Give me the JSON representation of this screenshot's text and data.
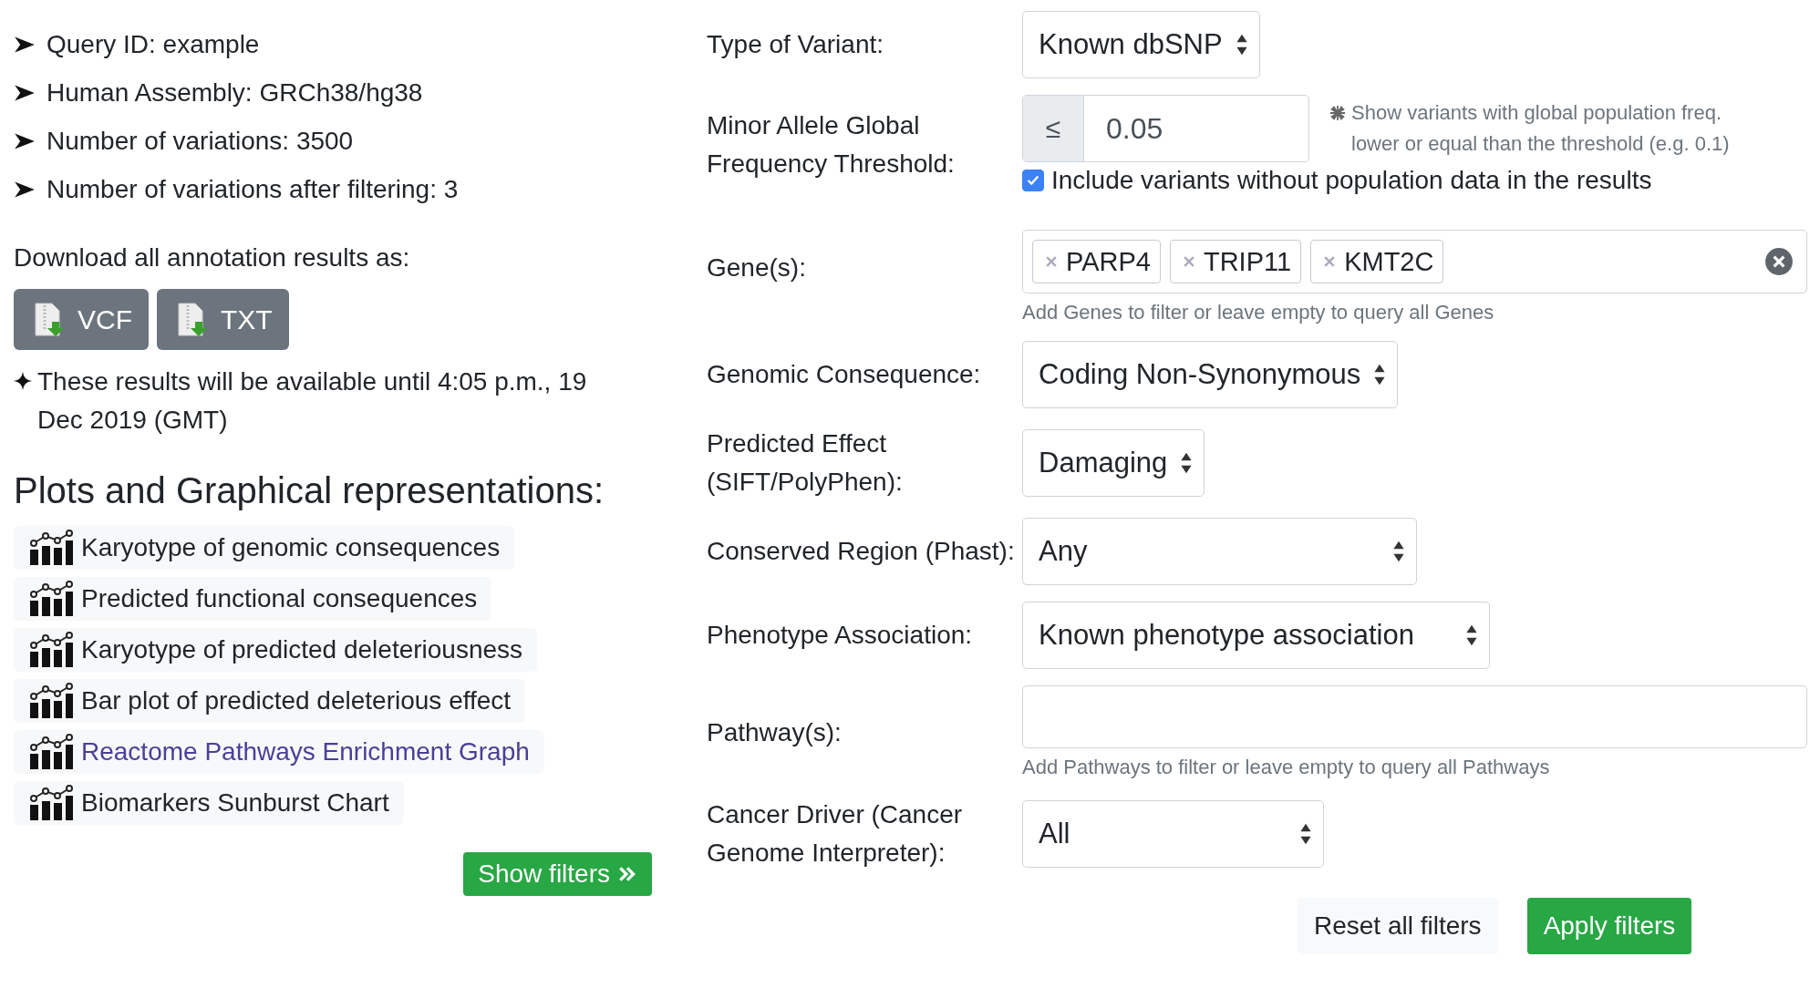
{
  "summary": [
    "Query ID: example",
    "Human Assembly: GRCh38/hg38",
    "Number of variations: 3500",
    "Number of variations after filtering: 3"
  ],
  "download": {
    "label": "Download all annotation results as:",
    "buttons": [
      "VCF",
      "TXT"
    ]
  },
  "availability": "These results will be available until 4:05 p.m., 19 Dec 2019 (GMT)",
  "plots": {
    "title": "Plots and Graphical representations:",
    "items": [
      {
        "label": "Karyotype of genomic consequences",
        "kind": "text"
      },
      {
        "label": "Predicted functional consequences",
        "kind": "text"
      },
      {
        "label": "Karyotype of predicted deleteriousness",
        "kind": "text"
      },
      {
        "label": "Bar plot of predicted deleterious effect",
        "kind": "text"
      },
      {
        "label": "Reactome Pathways Enrichment Graph",
        "kind": "link"
      },
      {
        "label": "Biomarkers Sunburst Chart",
        "kind": "text"
      }
    ]
  },
  "show_filters": "Show filters",
  "filters": [
    {
      "kind": "select",
      "label": "Type of Variant:",
      "value": "Known dbSNP"
    },
    {
      "kind": "threshold",
      "label": "Minor Allele Global Frequency Threshold:",
      "operator": "≤",
      "value": "0.05",
      "note": "Show variants with global population freq. lower or equal than the threshold (e.g. 0.1)",
      "checkbox": {
        "label": "Include variants without population data in the results",
        "checked": true
      }
    },
    {
      "kind": "tags",
      "label": "Gene(s):",
      "tags": [
        "PARP4",
        "TRIP11",
        "KMT2C"
      ],
      "help": "Add Genes to filter or leave empty to query all Genes"
    },
    {
      "kind": "select",
      "label": "Genomic Consequence:",
      "value": "Coding Non-Synonymous"
    },
    {
      "kind": "select",
      "label": "Predicted Effect (SIFT/PolyPhen):",
      "value": "Damaging"
    },
    {
      "kind": "select",
      "label": "Conserved Region (Phast):",
      "value": "Any"
    },
    {
      "kind": "select",
      "label": "Phenotype Association:",
      "value": "Known phenotype association"
    },
    {
      "kind": "text",
      "label": "Pathway(s):",
      "help": "Add Pathways to filter or leave empty to query all Pathways"
    },
    {
      "kind": "select",
      "label": "Cancer Driver (Cancer Genome Interpreter):",
      "value": "All"
    }
  ],
  "actions": {
    "reset": "Reset all filters",
    "apply": "Apply filters"
  }
}
